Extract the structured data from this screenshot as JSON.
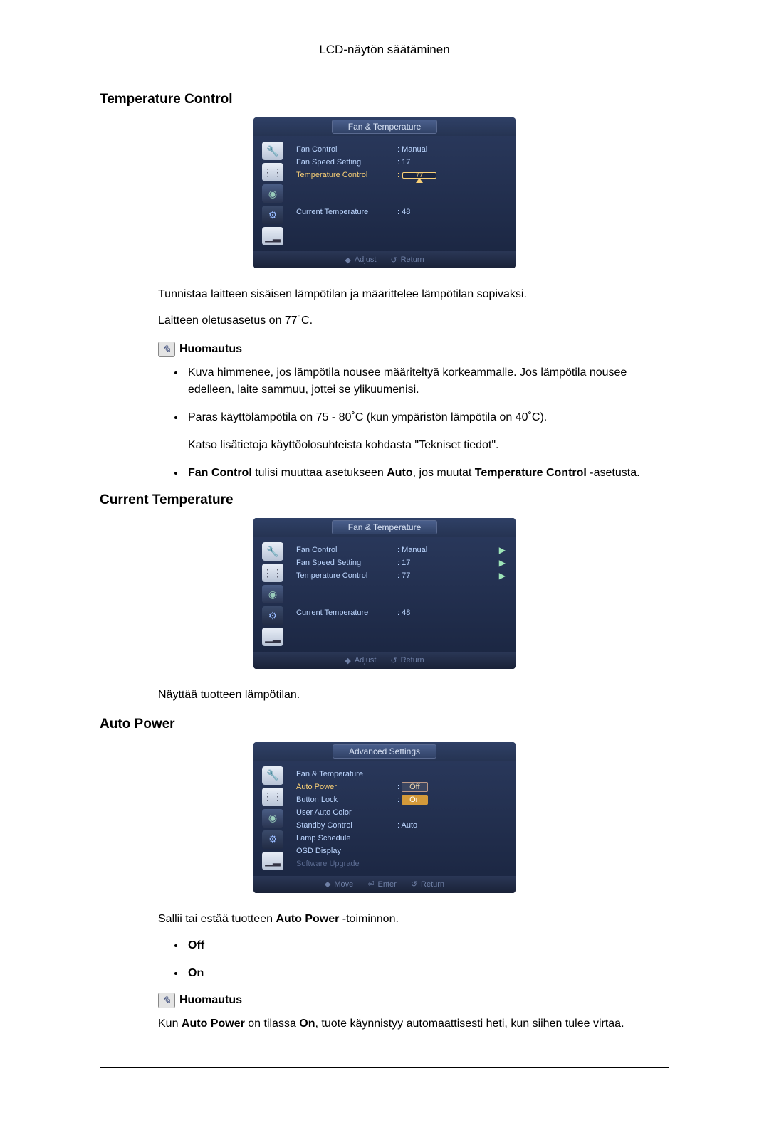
{
  "page_header": "LCD-näytön säätäminen",
  "sections": {
    "temp_control": {
      "heading": "Temperature Control",
      "osd": {
        "title": "Fan & Temperature",
        "rows": {
          "fan_control": {
            "label": "Fan Control",
            "value": ": Manual"
          },
          "fan_speed": {
            "label": "Fan Speed Setting",
            "value": ": 17"
          },
          "temp_ctrl": {
            "label": "Temperature Control",
            "value": "77"
          },
          "cur_temp": {
            "label": "Current Temperature",
            "value": ": 48"
          }
        },
        "footer": {
          "adjust": "Adjust",
          "return": "Return"
        }
      },
      "para1": "Tunnistaa laitteen sisäisen lämpötilan ja määrittelee lämpötilan sopivaksi.",
      "para2": "Laitteen oletusasetus on 77˚C.",
      "note_label": "Huomautus",
      "bullets": {
        "b1": "Kuva himmenee, jos lämpötila nousee määriteltyä korkeammalle. Jos lämpötila nousee edelleen, laite sammuu, jottei se ylikuumenisi.",
        "b2": "Paras käyttölämpötila on 75 - 80˚C (kun ympäristön lämpötila on 40˚C).",
        "b2b": "Katso lisätietoja käyttöolosuhteista kohdasta \"Tekniset tiedot\".",
        "b3_pre": "Fan Control",
        "b3_mid1": " tulisi muuttaa asetukseen ",
        "b3_auto": "Auto",
        "b3_mid2": ", jos muutat ",
        "b3_tc": "Temperature Control",
        "b3_end": " -asetusta."
      }
    },
    "current_temp": {
      "heading": "Current Temperature",
      "osd": {
        "title": "Fan & Temperature",
        "rows": {
          "fan_control": {
            "label": "Fan Control",
            "value": ": Manual"
          },
          "fan_speed": {
            "label": "Fan Speed Setting",
            "value": ": 17"
          },
          "temp_ctrl": {
            "label": "Temperature Control",
            "value": ": 77"
          },
          "cur_temp": {
            "label": "Current Temperature",
            "value": ": 48"
          }
        },
        "footer": {
          "adjust": "Adjust",
          "return": "Return"
        }
      },
      "para": "Näyttää tuotteen lämpötilan."
    },
    "auto_power": {
      "heading": "Auto Power",
      "osd": {
        "title": "Advanced Settings",
        "rows": {
          "fan_temp": {
            "label": "Fan & Temperature"
          },
          "auto_power": {
            "label": "Auto Power",
            "opt_off": "Off",
            "opt_on": "On"
          },
          "button_lock": {
            "label": "Button Lock"
          },
          "user_auto": {
            "label": "User Auto Color"
          },
          "standby": {
            "label": "Standby Control",
            "value": ": Auto"
          },
          "lamp": {
            "label": "Lamp Schedule"
          },
          "osd_disp": {
            "label": "OSD Display"
          },
          "sw_upg": {
            "label": "Software Upgrade"
          }
        },
        "footer": {
          "move": "Move",
          "enter": "Enter",
          "return": "Return"
        }
      },
      "para": "Sallii tai estää tuotteen ",
      "para_bold": "Auto Power",
      "para_end": " -toiminnon.",
      "opt_off": "Off",
      "opt_on": "On",
      "note_label": "Huomautus",
      "final_1": "Kun ",
      "final_b1": "Auto Power",
      "final_2": " on tilassa ",
      "final_b2": "On",
      "final_3": ", tuote käynnistyy automaattisesti heti, kun siihen tulee virtaa."
    }
  }
}
